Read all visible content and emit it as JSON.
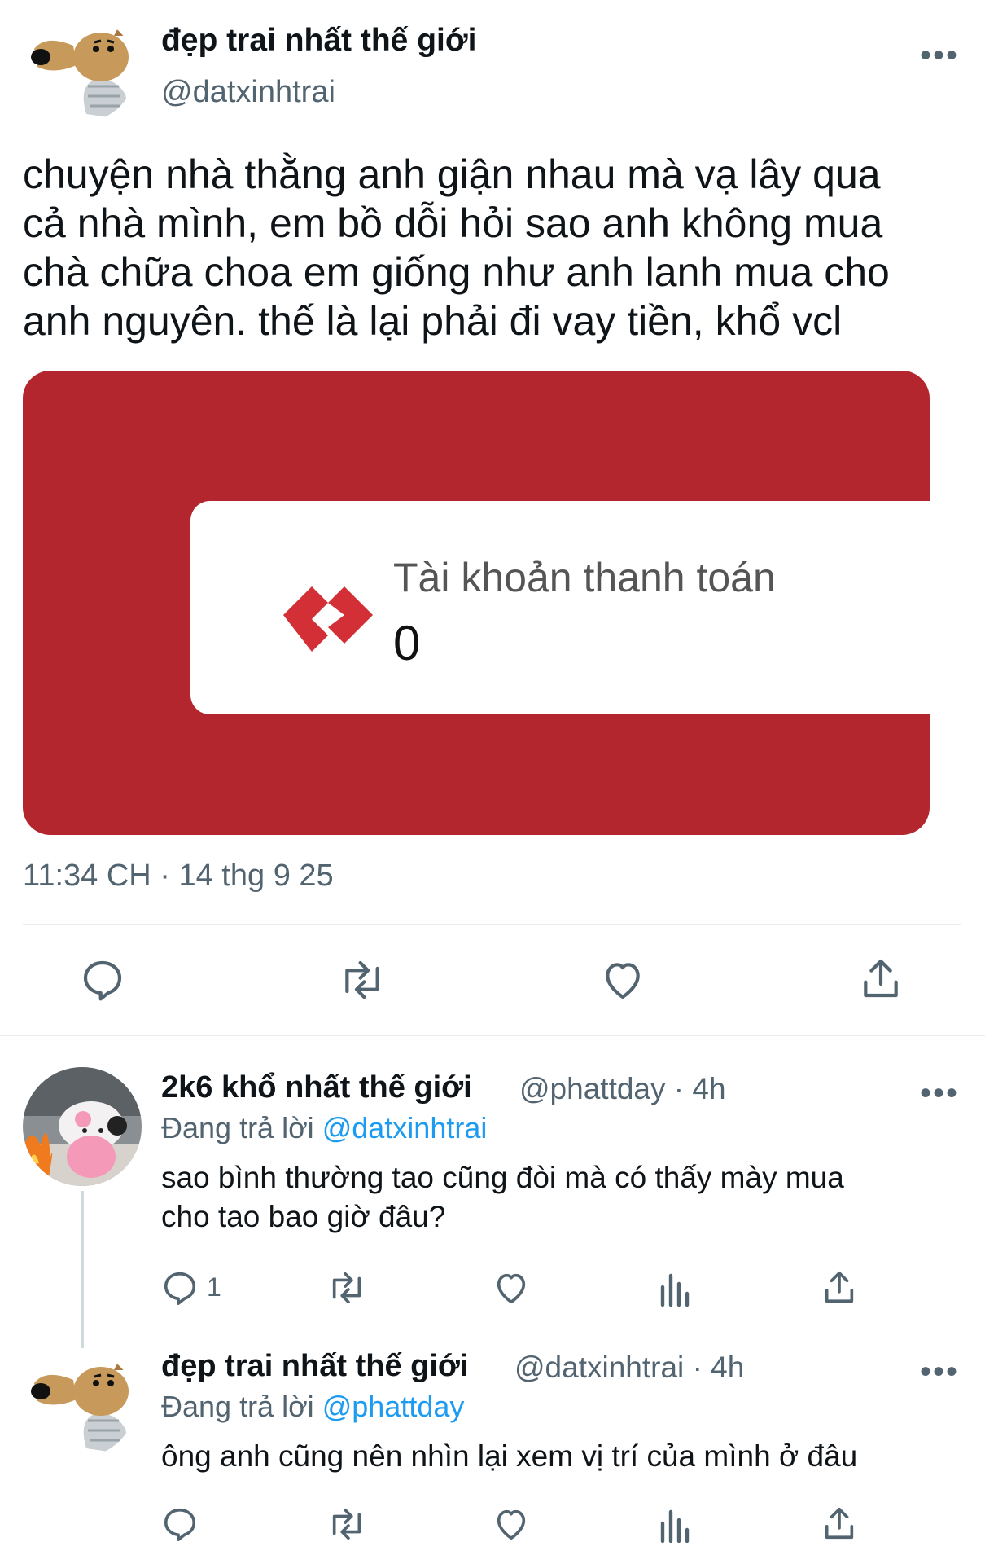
{
  "main_tweet": {
    "display_name": "đẹp trai nhất thế giới",
    "handle": "@datxinhtrai",
    "more": "•••",
    "text_lines": [
      "chuyện nhà thằng anh giận nhau mà vạ lây qua",
      "cả nhà mình, em bồ dỗi hỏi sao anh không mua",
      "chà chữa choa em giống như anh lanh mua cho",
      "anh nguyên. thế là lại phải đi vay tiền, khổ vcl"
    ],
    "media": {
      "title": "Tài khoản thanh toán",
      "amount": "0",
      "background_color": "#b3262d"
    },
    "timestamp": "11:34 CH · 14 thg 9 25",
    "actions": [
      "reply-icon",
      "retweet-icon",
      "like-icon",
      "share-icon"
    ]
  },
  "replies": [
    {
      "display_name": "2k6 khổ nhất thế giới",
      "handle": "@phattday",
      "time": "· 4h",
      "replying_label": "Đang trả lời",
      "replying_to": "@datxinhtrai",
      "text_lines": [
        "sao bình thường tao cũng đòi mà có thấy mày mua",
        "cho tao bao giờ đâu?"
      ],
      "reply_count": "1",
      "more": "•••"
    },
    {
      "display_name": "đẹp trai nhất thế giới",
      "handle": "@datxinhtrai",
      "time": "· 4h",
      "replying_label": "Đang trả lời",
      "replying_to": "@phattday",
      "text_lines": [
        "ông anh cũng nên nhìn lại xem vị trí của mình ở đâu"
      ],
      "more": "•••"
    }
  ],
  "colors": {
    "accent": "#1d9bf0",
    "secondary_text": "#536471",
    "divider": "#e6ecf0"
  }
}
